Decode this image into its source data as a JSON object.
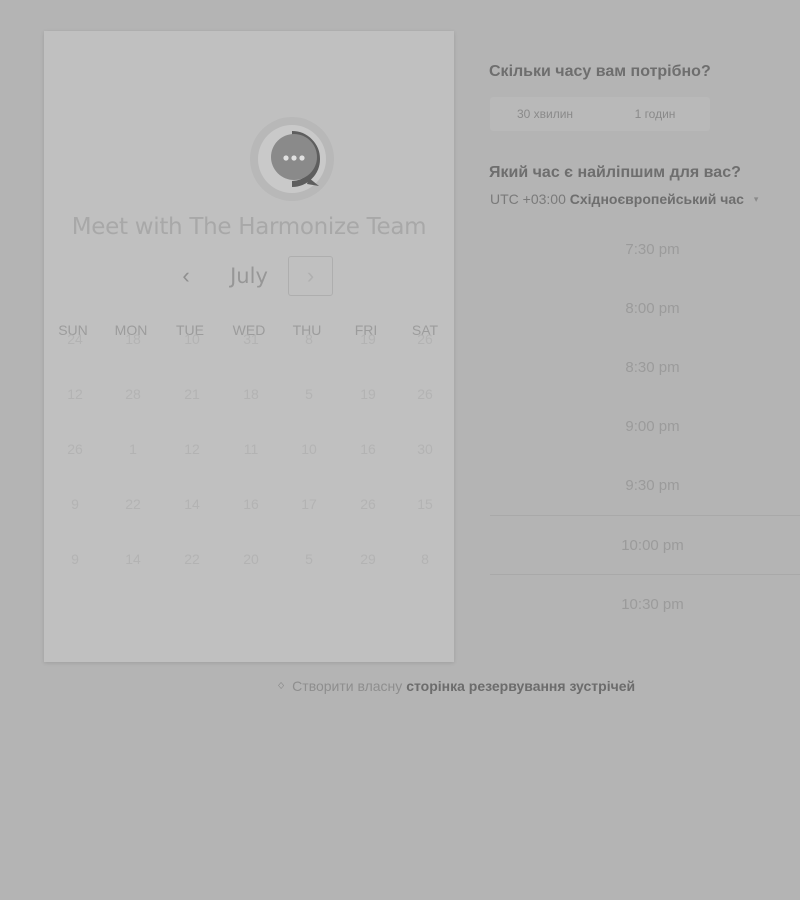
{
  "card": {
    "title": "Meet with The Harmonize Team",
    "month": "July",
    "prev_icon": "‹",
    "next_icon": "›",
    "weekdays": [
      "SUN",
      "MON",
      "TUE",
      "WED",
      "THU",
      "FRI",
      "SAT"
    ],
    "weeks": [
      [
        "24",
        "18",
        "10",
        "31",
        "8",
        "19",
        "26"
      ],
      [
        "12",
        "28",
        "21",
        "18",
        "5",
        "19",
        "26"
      ],
      [
        "26",
        "1",
        "12",
        "11",
        "10",
        "16",
        "30"
      ],
      [
        "9",
        "22",
        "14",
        "16",
        "17",
        "26",
        "15"
      ],
      [
        "9",
        "14",
        "22",
        "20",
        "5",
        "29",
        "8"
      ]
    ]
  },
  "duration": {
    "question": "Скільки часу вам потрібно?",
    "options": [
      "30 хвилин",
      "1 годин"
    ]
  },
  "time": {
    "question": "Який час є найліпшим для вас?",
    "tz_offset": "UTC +03:00",
    "tz_name": "Східноєвропейський час",
    "caret_icon": "▾",
    "slots": [
      "7:30 pm",
      "8:00 pm",
      "8:30 pm",
      "9:00 pm",
      "9:30 pm",
      "10:00 pm",
      "10:30 pm"
    ]
  },
  "footer": {
    "prefix": "Створити власну",
    "link": "сторінка резервування зустрічей",
    "icon": "sprocket-icon"
  }
}
